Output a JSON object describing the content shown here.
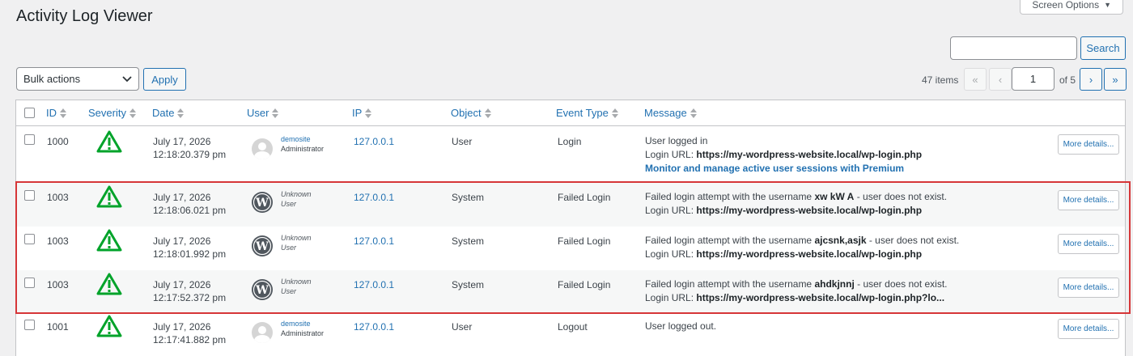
{
  "page": {
    "title": "Activity Log Viewer"
  },
  "screen_options": {
    "label": "Screen Options"
  },
  "search": {
    "placeholder": "",
    "button_label": "Search"
  },
  "bulk": {
    "selected": "Bulk actions",
    "apply_label": "Apply"
  },
  "pagination": {
    "items_label": "47 items",
    "first": "«",
    "prev": "‹",
    "next": "›",
    "last": "»",
    "current_page": "1",
    "of_label": "of 5"
  },
  "columns": [
    "ID",
    "Severity",
    "Date",
    "User",
    "IP",
    "Object",
    "Event Type",
    "Message"
  ],
  "rows": [
    {
      "id": "1000",
      "date": "July 17, 2026",
      "time": "12:18:20.379 pm",
      "user_name": "demosite",
      "user_role": "Administrator",
      "ip": "127.0.0.1",
      "object": "User",
      "event": "Login",
      "msg1_pre": "User logged in",
      "msg1_bold": "",
      "msg1_post": "",
      "msg2_pre": "Login URL: ",
      "msg2_bold": "https://my-wordpress-website.local/wp-login.php",
      "msg3_link": "Monitor and manage active user sessions with Premium",
      "more": "More details..."
    },
    {
      "id": "1003",
      "date": "July 17, 2026",
      "time": "12:18:06.021 pm",
      "user_name": "Unknown",
      "user_role": "User",
      "ip": "127.0.0.1",
      "object": "System",
      "event": "Failed Login",
      "msg1_pre": "Failed login attempt with the username ",
      "msg1_bold": "xw kW A",
      "msg1_post": " - user does not exist.",
      "msg2_pre": "Login URL: ",
      "msg2_bold": "https://my-wordpress-website.local/wp-login.php",
      "more": "More details..."
    },
    {
      "id": "1003",
      "date": "July 17, 2026",
      "time": "12:18:01.992 pm",
      "user_name": "Unknown",
      "user_role": "User",
      "ip": "127.0.0.1",
      "object": "System",
      "event": "Failed Login",
      "msg1_pre": "Failed login attempt with the username ",
      "msg1_bold": "ajcsnk,asjk",
      "msg1_post": " - user does not exist.",
      "msg2_pre": "Login URL: ",
      "msg2_bold": "https://my-wordpress-website.local/wp-login.php",
      "more": "More details..."
    },
    {
      "id": "1003",
      "date": "July 17, 2026",
      "time": "12:17:52.372 pm",
      "user_name": "Unknown",
      "user_role": "User",
      "ip": "127.0.0.1",
      "object": "System",
      "event": "Failed Login",
      "msg1_pre": "Failed login attempt with the username ",
      "msg1_bold": "ahdkjnnj",
      "msg1_post": " - user does not exist.",
      "msg2_pre": "Login URL: ",
      "msg2_bold": "https://my-wordpress-website.local/wp-login.php?lo...",
      "more": "More details..."
    },
    {
      "id": "1001",
      "date": "July 17, 2026",
      "time": "12:17:41.882 pm",
      "user_name": "demosite",
      "user_role": "Administrator",
      "ip": "127.0.0.1",
      "object": "User",
      "event": "Logout",
      "msg1_pre": "User logged out.",
      "msg1_bold": "",
      "msg1_post": "",
      "more": "More details..."
    }
  ],
  "colors": {
    "accent": "#2271b1",
    "warning_green": "#00a32a",
    "highlight": "#d63638"
  },
  "icons": {
    "severity": "warning-triangle-icon",
    "unknown_user": "wordpress-logo-icon",
    "known_user": "default-avatar-icon"
  }
}
